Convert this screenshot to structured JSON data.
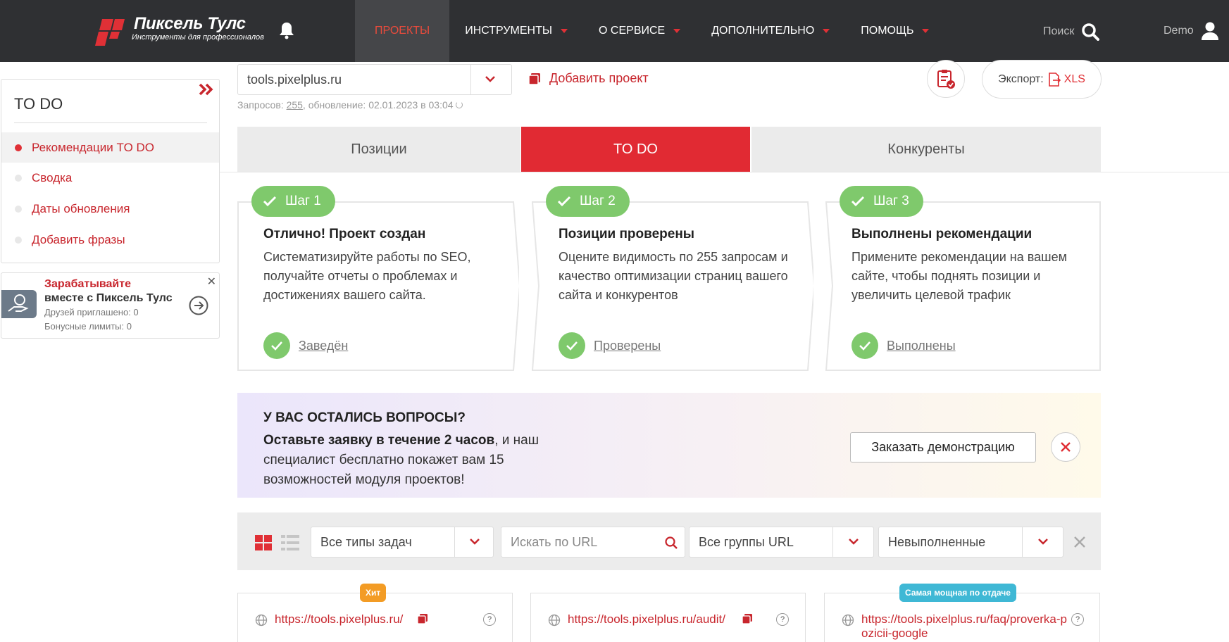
{
  "header": {
    "logo_title": "Пиксель Тулс",
    "logo_subtitle": "Инструменты для профессионалов",
    "nav": [
      {
        "label": "ПРОЕКТЫ",
        "active": true,
        "dropdown": false
      },
      {
        "label": "ИНСТРУМЕНТЫ",
        "active": false,
        "dropdown": true
      },
      {
        "label": "О СЕРВИСЕ",
        "active": false,
        "dropdown": true
      },
      {
        "label": "ДОПОЛНИТЕЛЬНО",
        "active": false,
        "dropdown": true
      },
      {
        "label": "ПОМОЩЬ",
        "active": false,
        "dropdown": true
      }
    ],
    "search_label": "Поиск",
    "user_label": "Demo"
  },
  "sidebar": {
    "title": "TO DO",
    "items": [
      {
        "label": "Рекомендации TO DO",
        "active": true
      },
      {
        "label": "Сводка",
        "active": false
      },
      {
        "label": "Даты обновления",
        "active": false
      },
      {
        "label": "Добавить фразы",
        "active": false
      }
    ]
  },
  "referral": {
    "title_line1": "Зарабатывайте",
    "title_line2": "вместе с Пиксель Тулс",
    "friends": "Друзей приглашено: 0",
    "bonus": "Бонусные лимиты: 0"
  },
  "project": {
    "selected": "tools.pixelplus.ru",
    "add_label": "Добавить проект",
    "stats_prefix": "Запросов: ",
    "stats_count": "255",
    "stats_suffix": ", обновление: 02.01.2023 в 03:04",
    "export_label": "Экспорт:",
    "export_format": "XLS"
  },
  "tabs": [
    {
      "label": "Позиции",
      "active": false
    },
    {
      "label": "TO DO",
      "active": true
    },
    {
      "label": "Конкуренты",
      "active": false
    }
  ],
  "steps": [
    {
      "badge": "Шаг 1",
      "title": "Отлично! Проект создан",
      "text": "Систематизируйте работы по SEO, получайте отчеты о проблемах и достижениях вашего сайта.",
      "status": "Заведён"
    },
    {
      "badge": "Шаг 2",
      "title": "Позиции проверены",
      "text": "Оцените видимость по 255 запросам и качество оптимизации страниц вашего сайта и конкурентов",
      "status": "Проверены"
    },
    {
      "badge": "Шаг 3",
      "title": "Выполнены рекомендации",
      "text": "Примените рекомендации на вашем сайте, чтобы поднять позиции и увеличить целевой трафик",
      "status": "Выполнены"
    }
  ],
  "banner": {
    "question": "У ВАС ОСТАЛИСЬ ВОПРОСЫ?",
    "bold": "Оставьте заявку в течение 2 часов",
    "text": ", и наш специалист бесплатно покажет вам 15 возможностей модуля проектов!",
    "button": "Заказать демонстрацию"
  },
  "filters": {
    "task_type": "Все типы задач",
    "search_placeholder": "Искать по URL",
    "url_groups": "Все группы URL",
    "status": "Невыполненные"
  },
  "cards": [
    {
      "url": "https://tools.pixelplus.ru/",
      "tag": "Хит",
      "tag_color": "#f39c25"
    },
    {
      "url": "https://tools.pixelplus.ru/audit/",
      "tag": "",
      "tag_color": ""
    },
    {
      "url": "https://tools.pixelplus.ru/faq/proverka-pozicii-google",
      "tag": "Самая мощная по отдаче",
      "tag_color": "#3fb8d5"
    }
  ],
  "colors": {
    "brand_red": "#e12a33",
    "header_bg": "#2f3033",
    "success_green": "#7fc96c"
  }
}
